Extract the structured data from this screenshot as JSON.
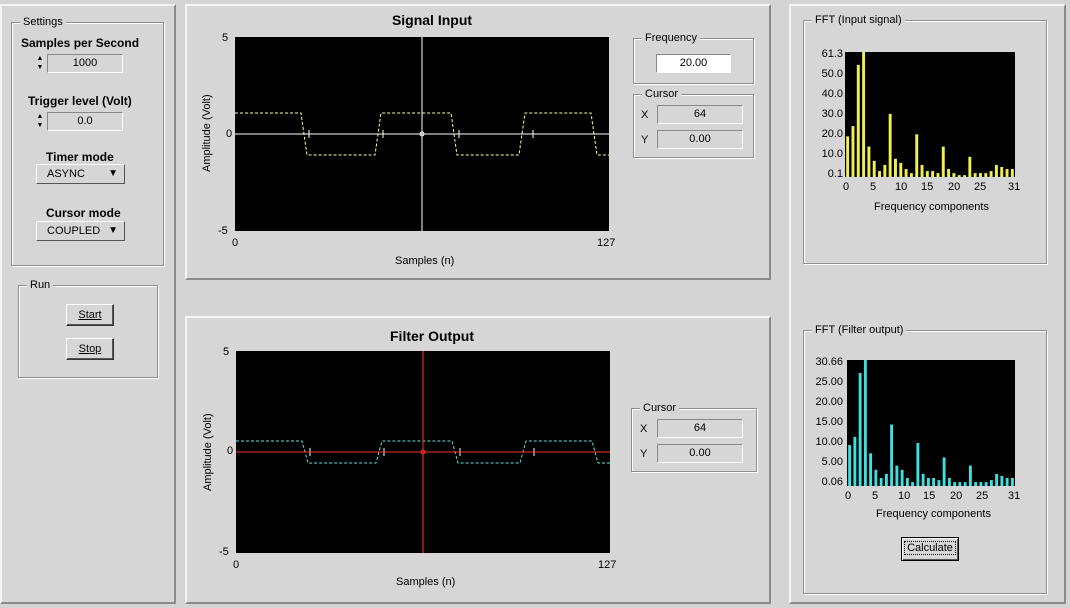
{
  "settings": {
    "group_title": "Settings",
    "samples_label": "Samples per Second",
    "samples_value": "1000",
    "trigger_label": "Trigger level (Volt)",
    "trigger_value": "0.0",
    "timer_label": "Timer mode",
    "timer_value": "ASYNC",
    "cursor_mode_label": "Cursor mode",
    "cursor_mode_value": "COUPLED"
  },
  "run": {
    "group_title": "Run",
    "start_label": "Start",
    "stop_label": "Stop"
  },
  "signal_input": {
    "title": "Signal Input",
    "ylabel": "Amplitude (Volt)",
    "xlabel": "Samples (n)",
    "y_max": "5",
    "y_mid": "0",
    "y_min": "-5",
    "x_min": "0",
    "x_max": "127",
    "frequency_title": "Frequency",
    "frequency_value": "20.00",
    "cursor_title": "Cursor",
    "cursor_x_label": "X",
    "cursor_x_value": "64",
    "cursor_y_label": "Y",
    "cursor_y_value": "0.00"
  },
  "filter_output": {
    "title": "Filter Output",
    "ylabel": "Amplitude (Volt)",
    "xlabel": "Samples (n)",
    "y_max": "5",
    "y_mid": "0",
    "y_min": "-5",
    "x_min": "0",
    "x_max": "127",
    "cursor_title": "Cursor",
    "cursor_x_label": "X",
    "cursor_x_value": "64",
    "cursor_y_label": "Y",
    "cursor_y_value": "0.00"
  },
  "fft_input": {
    "group_title": "FFT  (Input signal)",
    "xlabel": "Frequency components",
    "yticks": [
      "61.3",
      "50.0",
      "40.0",
      "30.0",
      "20.0",
      "10.0",
      "0.1"
    ],
    "xticks": [
      "0",
      "5",
      "10",
      "15",
      "20",
      "25",
      "31"
    ]
  },
  "fft_output": {
    "group_title": "FFT (Filter output)",
    "xlabel": "Frequency components",
    "yticks": [
      "30.66",
      "25.00",
      "20.00",
      "15.00",
      "10.00",
      "5.00",
      "0.06"
    ],
    "xticks": [
      "0",
      "5",
      "10",
      "15",
      "20",
      "25",
      "31"
    ],
    "calculate_label": "Calculate"
  },
  "colors": {
    "input_trace": "#ffff99",
    "output_trace": "#66e0e0",
    "input_cursor": "#ffffff",
    "output_cursor": "#ff3030",
    "fft_input_bars": "#f0f050",
    "fft_output_bars": "#40e0e0"
  },
  "chart_data": [
    {
      "type": "bar",
      "xlabel": "Frequency components",
      "ylim": [
        0.1,
        61.3
      ],
      "x": [
        0,
        1,
        2,
        3,
        4,
        5,
        6,
        7,
        8,
        9,
        10,
        11,
        12,
        13,
        14,
        15,
        16,
        17,
        18,
        19,
        20,
        21,
        22,
        23,
        24,
        25,
        26,
        27,
        28,
        29,
        30,
        31
      ],
      "values": [
        20,
        25,
        55,
        61.3,
        15,
        8,
        3,
        6,
        31,
        9,
        7,
        4,
        2,
        21,
        6,
        3,
        3,
        2,
        15,
        4,
        2,
        1,
        1,
        10,
        2,
        2,
        2,
        3,
        6,
        5,
        4,
        4
      ]
    },
    {
      "type": "bar",
      "xlabel": "Frequency components",
      "ylim": [
        0.06,
        30.66
      ],
      "x": [
        0,
        1,
        2,
        3,
        4,
        5,
        6,
        7,
        8,
        9,
        10,
        11,
        12,
        13,
        14,
        15,
        16,
        17,
        18,
        19,
        20,
        21,
        22,
        23,
        24,
        25,
        26,
        27,
        28,
        29,
        30,
        31
      ],
      "values": [
        10,
        12,
        27.5,
        30.66,
        8,
        4,
        2,
        3,
        15,
        5,
        4,
        2,
        1,
        10.5,
        3,
        2,
        2,
        1.5,
        7,
        2,
        1,
        1,
        1,
        5,
        1,
        1,
        1,
        1.5,
        3,
        2.5,
        2,
        2
      ]
    }
  ]
}
